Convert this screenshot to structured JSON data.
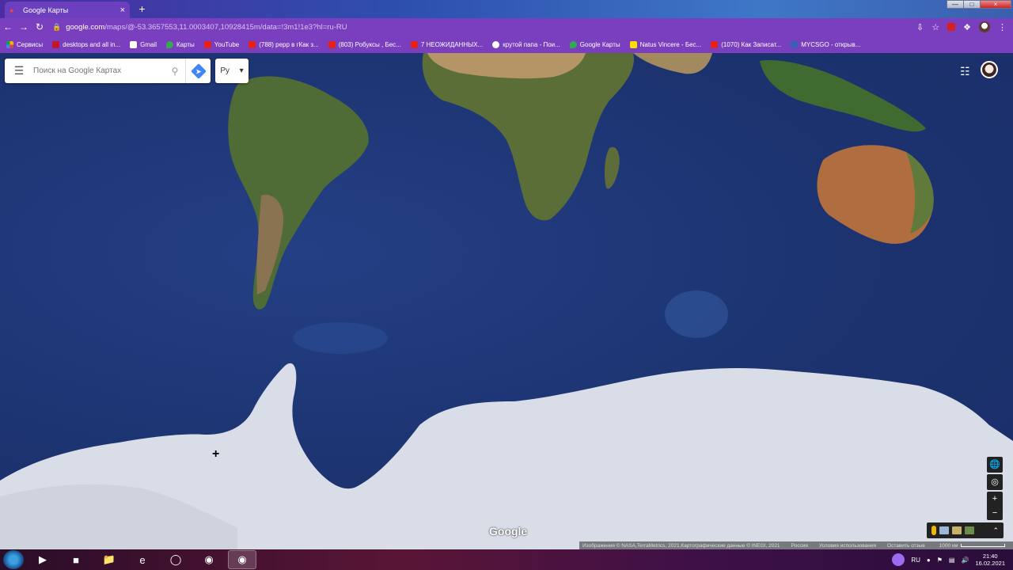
{
  "browser": {
    "tab_title": "Google Карты",
    "new_tab": "+",
    "url_host": "google.com",
    "url_path": "/maps/@-53.3657553,11.0003407,10928415m/data=!3m1!1e3?hl=ru-RU"
  },
  "bookmarks": [
    {
      "label": "Сервисы",
      "icon": "grid"
    },
    {
      "label": "desktops and all in...",
      "icon": "l"
    },
    {
      "label": "Gmail",
      "icon": "g"
    },
    {
      "label": "Карты",
      "icon": "pin"
    },
    {
      "label": "YouTube",
      "icon": "yt"
    },
    {
      "label": "(788) рерр в гКак з...",
      "icon": "yt"
    },
    {
      "label": "(803) Робуксы , Бес...",
      "icon": "yt"
    },
    {
      "label": "7 НЕОЖИДАННЫХ...",
      "icon": "yt"
    },
    {
      "label": "крутой папа - Пои...",
      "icon": "goo"
    },
    {
      "label": "Google Карты",
      "icon": "pin"
    },
    {
      "label": "Natus Vincere - Бес...",
      "icon": "navi"
    },
    {
      "label": "(1070) Как Записат...",
      "icon": "yt"
    },
    {
      "label": "MYCSGO - открыв...",
      "icon": "csgo"
    }
  ],
  "map": {
    "search_placeholder": "Поиск на Google Картах",
    "layer_label": "Ру",
    "google_logo": "Google",
    "attribution": {
      "imagery": "Изображения © NASA,TerraMetrics, 2021,Картографические данные © INEGI, 2021",
      "country": "Россия",
      "terms": "Условия использования",
      "feedback": "Оставить отзыв",
      "scale": "1000 км"
    }
  },
  "taskbar": {
    "lang": "RU",
    "time": "21:40",
    "date": "16.02.2021"
  }
}
